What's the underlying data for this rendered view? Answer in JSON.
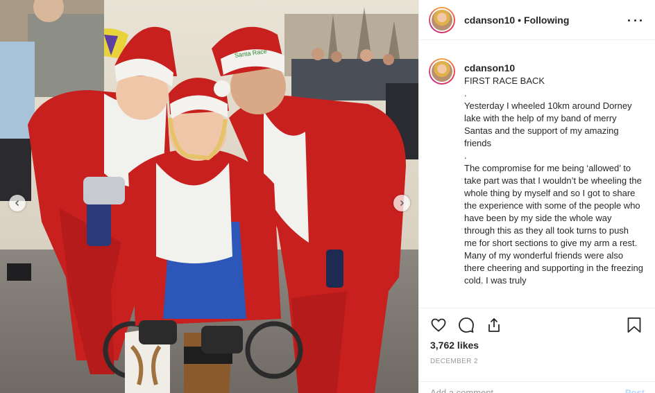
{
  "post": {
    "username": "cdanson10",
    "follow_status": "Following",
    "more_label": "More options"
  },
  "caption": {
    "username": "cdanson10",
    "lines": [
      "FIRST RACE BACK",
      ".",
      "Yesterday I wheeled 10km around Dorney lake with the help of my band of merry Santas and the support of my amazing friends",
      ".",
      "The compromise for me being ‘allowed’ to take part was that I wouldn’t be wheeling the whole thing by myself and so I got to share the experience with some of the people who have been by my side the whole way through this as they all took turns to push me for short sections to give my arm a rest. Many of my wonderful friends were also there cheering and supporting in the freezing cold. I was truly"
    ]
  },
  "actions": {
    "like_icon": "heart-icon",
    "comment_icon": "comment-icon",
    "share_icon": "share-icon",
    "save_icon": "bookmark-icon"
  },
  "likes": "3,762 likes",
  "date": "DECEMBER 2",
  "comment_box": {
    "placeholder": "Add a comment…",
    "post_label": "Post"
  },
  "photo": {
    "hat_text": "Santa Race"
  },
  "colors": {
    "santa_red": "#c8201e",
    "background_pane": "#ffffff",
    "post_button": "#b3dbff",
    "date_grey": "#999999"
  }
}
